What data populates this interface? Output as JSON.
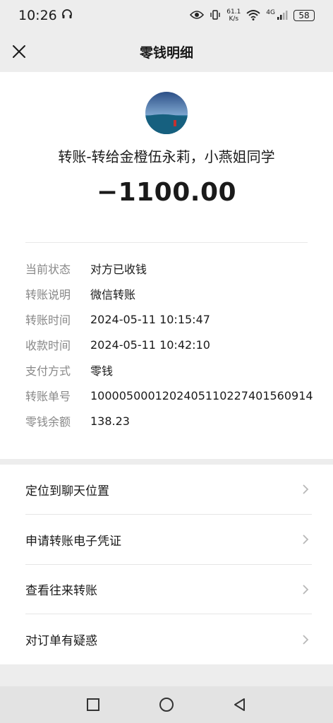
{
  "status_bar": {
    "time": "10:26",
    "net_speed_value": "61.1",
    "net_speed_unit": "K/s",
    "network": "4G",
    "battery": "58"
  },
  "navbar": {
    "title": "零钱明细"
  },
  "transaction": {
    "title": "转账-转给金橙伍永莉，小燕姐同学",
    "amount": "−1100.00"
  },
  "details": [
    {
      "label": "当前状态",
      "value": "对方已收钱"
    },
    {
      "label": "转账说明",
      "value": "微信转账"
    },
    {
      "label": "转账时间",
      "value": "2024-05-11 10:15:47"
    },
    {
      "label": "收款时间",
      "value": "2024-05-11 10:42:10"
    },
    {
      "label": "支付方式",
      "value": "零钱"
    },
    {
      "label": "转账单号",
      "value": "100005000120240511022740​1560914"
    },
    {
      "label": "零钱余额",
      "value": "138.23"
    }
  ],
  "actions": [
    {
      "label": "定位到聊天位置"
    },
    {
      "label": "申请转账电子凭证"
    },
    {
      "label": "查看往来转账"
    },
    {
      "label": "对订单有疑惑"
    }
  ],
  "icons": {
    "close": "close-icon",
    "chevron": "chevron-right-icon",
    "home": "circle-home-icon",
    "back": "triangle-back-icon",
    "recents": "square-recents-icon"
  }
}
